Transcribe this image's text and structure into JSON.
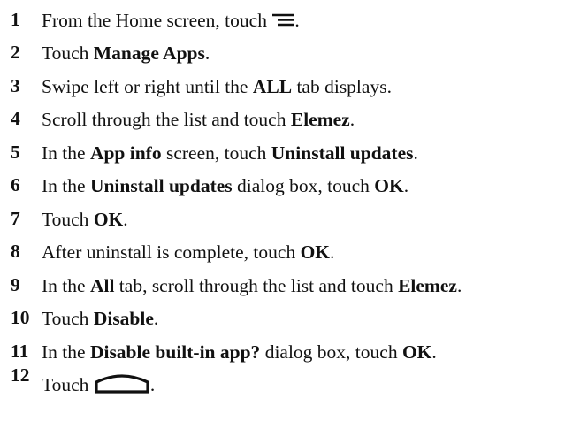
{
  "steps": [
    {
      "number": "1",
      "parts": [
        {
          "text": "From the Home screen, touch "
        },
        {
          "icon": "menu-icon"
        },
        {
          "text": "."
        }
      ]
    },
    {
      "number": "2",
      "parts": [
        {
          "text": "Touch "
        },
        {
          "text": "Manage Apps",
          "bold": true
        },
        {
          "text": "."
        }
      ]
    },
    {
      "number": "3",
      "parts": [
        {
          "text": "Swipe left or right until the "
        },
        {
          "text": "ALL",
          "bold": true
        },
        {
          "text": " tab displays."
        }
      ]
    },
    {
      "number": "4",
      "parts": [
        {
          "text": "Scroll through the list and touch "
        },
        {
          "text": "Elemez",
          "bold": true
        },
        {
          "text": "."
        }
      ]
    },
    {
      "number": "5",
      "parts": [
        {
          "text": "In the "
        },
        {
          "text": "App info",
          "bold": true
        },
        {
          "text": " screen, touch "
        },
        {
          "text": "Uninstall updates",
          "bold": true
        },
        {
          "text": "."
        }
      ]
    },
    {
      "number": "6",
      "parts": [
        {
          "text": "In the "
        },
        {
          "text": "Uninstall updates",
          "bold": true
        },
        {
          "text": " dialog box, touch "
        },
        {
          "text": "OK",
          "bold": true
        },
        {
          "text": "."
        }
      ]
    },
    {
      "number": "7",
      "parts": [
        {
          "text": "Touch "
        },
        {
          "text": "OK",
          "bold": true
        },
        {
          "text": "."
        }
      ]
    },
    {
      "number": "8",
      "parts": [
        {
          "text": "After uninstall is complete, touch "
        },
        {
          "text": "OK",
          "bold": true
        },
        {
          "text": "."
        }
      ]
    },
    {
      "number": "9",
      "parts": [
        {
          "text": "In the "
        },
        {
          "text": "All",
          "bold": true
        },
        {
          "text": " tab, scroll through the list and touch "
        },
        {
          "text": "Elemez",
          "bold": true
        },
        {
          "text": "."
        }
      ]
    },
    {
      "number": "10",
      "parts": [
        {
          "text": "Touch "
        },
        {
          "text": "Disable",
          "bold": true
        },
        {
          "text": "."
        }
      ]
    },
    {
      "number": "11",
      "parts": [
        {
          "text": "In the "
        },
        {
          "text": "Disable built-in app?",
          "bold": true
        },
        {
          "text": " dialog box, touch "
        },
        {
          "text": "OK",
          "bold": true
        },
        {
          "text": "."
        }
      ]
    },
    {
      "number": "12",
      "parts": [
        {
          "text": "Touch "
        },
        {
          "icon": "home-icon"
        },
        {
          "text": "."
        }
      ]
    }
  ]
}
